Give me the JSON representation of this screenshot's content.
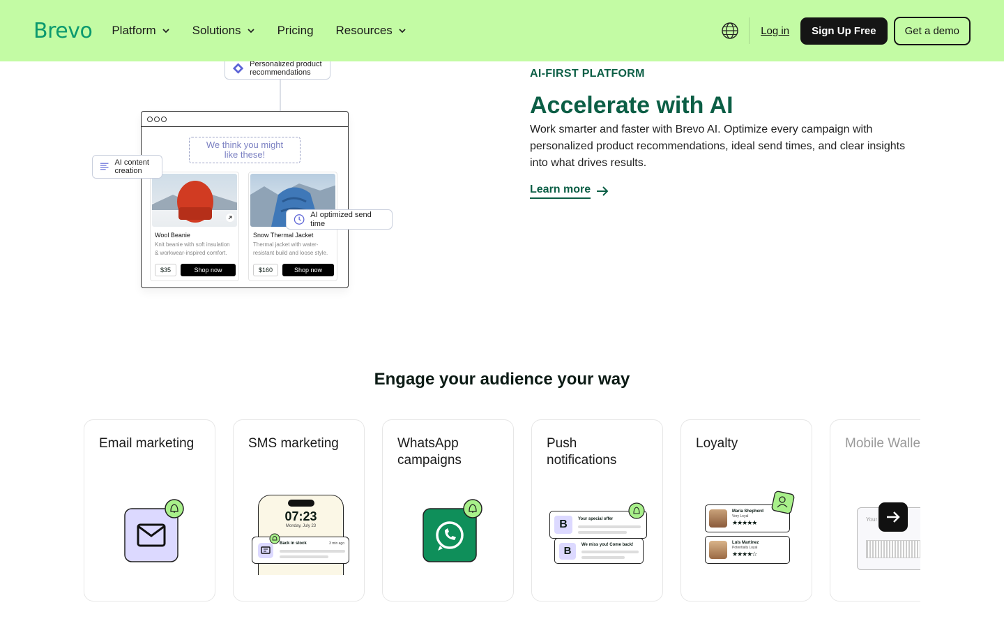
{
  "header": {
    "logo": "Brevo",
    "nav": [
      {
        "label": "Platform",
        "dropdown": true
      },
      {
        "label": "Solutions",
        "dropdown": true
      },
      {
        "label": "Pricing",
        "dropdown": false
      },
      {
        "label": "Resources",
        "dropdown": true
      }
    ],
    "login": "Log in",
    "signup": "Sign Up Free",
    "demo": "Get a demo",
    "icons": [
      "globe-icon",
      "chevron-down-icon"
    ]
  },
  "illustration": {
    "recommend_badge": "Personalized product recommendations",
    "content_badge": "AI content creation",
    "send_time_badge": "AI optimized send time",
    "suggestion_line1": "We think you might",
    "suggestion_line2": "like these!",
    "products": [
      {
        "title": "Wool Beanie",
        "desc": "Knit beanie with soft insulation & workwear-inspired comfort.",
        "price": "$35",
        "cta": "Shop now"
      },
      {
        "title": "Snow Thermal Jacket",
        "desc": "Thermal jacket with water-resistant build and loose style.",
        "price": "$160",
        "cta": "Shop now"
      }
    ]
  },
  "feature": {
    "eyebrow": "AI-FIRST PLATFORM",
    "title": "Accelerate with AI",
    "description": "Work smarter and faster with Brevo AI. Optimize every campaign with personalized product recommendations, ideal send times, and clear insights into what drives results.",
    "link": "Learn more"
  },
  "channels": {
    "title": "Engage your audience your way",
    "cards": [
      {
        "label": "Email marketing"
      },
      {
        "label": "SMS marketing",
        "time": "07:23",
        "date": "Monday, July 23",
        "notif_title": "Back in stock",
        "notif_time": "3 min ago"
      },
      {
        "label": "WhatsApp campaigns"
      },
      {
        "label": "Push notifications",
        "push1": "Your special offer",
        "push2": "We miss you! Come back!"
      },
      {
        "label": "Loyalty",
        "member1": "Maria Shepherd",
        "member1_status": "Very Loyal",
        "member2": "Luis Martinez",
        "member2_status": "Potentially Loyal"
      },
      {
        "label": "Mobile Walle",
        "wallet_text": "Your"
      }
    ]
  },
  "colors": {
    "header_bg": "#c3fba4",
    "brand_green": "#0b996e",
    "dark_green": "#0b5e45",
    "email_tile": "#dcd9ff",
    "whatsapp": "#0f8f5a",
    "bell_badge": "#a8f08a"
  }
}
